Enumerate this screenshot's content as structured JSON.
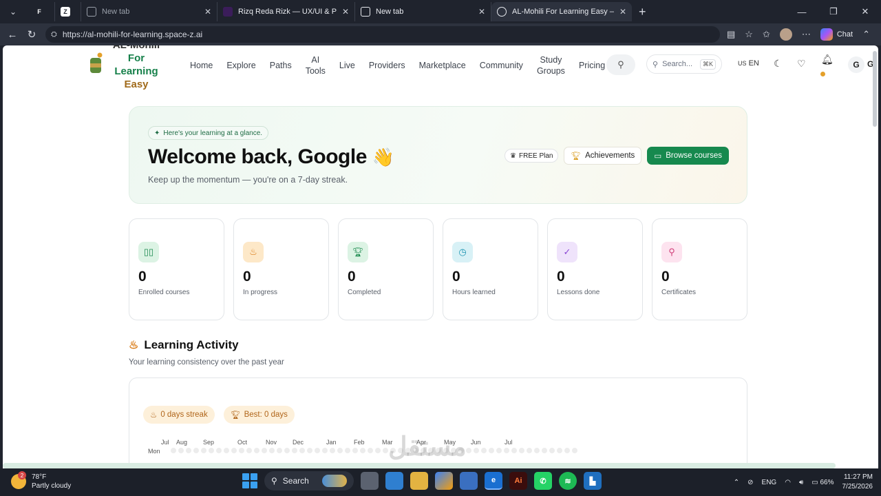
{
  "browser": {
    "tabs": [
      {
        "label": "",
        "favicon": "F",
        "color": "#ffffff"
      },
      {
        "label": "",
        "favicon": "Z",
        "color": "#ffffff"
      },
      {
        "label": "New tab",
        "favicon": "",
        "color": "#9aa0aa"
      },
      {
        "label": "Rizq Reda Rizk — UX/UI & Produc",
        "favicon": "",
        "color": "#e9ebf0"
      },
      {
        "label": "New tab",
        "favicon": "",
        "color": "#e9ebf0"
      },
      {
        "label": "AL-Mohili For Learning Easy — Ent",
        "favicon": "",
        "color": "#e9ebf0"
      }
    ],
    "url": "https://al-mohili-for-learning.space-z.ai",
    "chat_label": "Chat"
  },
  "header": {
    "logo_top": "AL-Mohili",
    "logo_for": "For",
    "logo_learning": "Learning",
    "logo_easy": "Easy",
    "nav": {
      "home": "Home",
      "explore": "Explore",
      "paths": "Paths",
      "ai_tools_1": "AI",
      "ai_tools_2": "Tools",
      "live": "Live",
      "providers": "Providers",
      "marketplace": "Marketplace",
      "community": "Community",
      "study_groups_1": "Study",
      "study_groups_2": "Groups",
      "pricing": "Pricing"
    },
    "search_placeholder": "Search...",
    "search_kbd": "⌘K",
    "lang_flag": "US",
    "lang": "EN",
    "user_initial": "G"
  },
  "hero": {
    "pill": "Here's your learning at a glance.",
    "title": "Welcome back, Google",
    "subtitle": "Keep up the momentum — you're on a 7-day streak.",
    "plan": "FREE Plan",
    "achievements": "Achievements",
    "browse": "Browse courses"
  },
  "stats": [
    {
      "value": "0",
      "label": "Enrolled courses",
      "icon": "book-icon",
      "bg": "#dcf3e4",
      "fg": "#1c8a4f"
    },
    {
      "value": "0",
      "label": "In progress",
      "icon": "flame-icon",
      "bg": "#fde8c8",
      "fg": "#d97a15"
    },
    {
      "value": "0",
      "label": "Completed",
      "icon": "trophy-icon",
      "bg": "#dcf3e4",
      "fg": "#1c8a4f"
    },
    {
      "value": "0",
      "label": "Hours learned",
      "icon": "clock-icon",
      "bg": "#d8f1f6",
      "fg": "#1b93b0"
    },
    {
      "value": "0",
      "label": "Lessons done",
      "icon": "check-circle-icon",
      "bg": "#efe3fb",
      "fg": "#8a45d4"
    },
    {
      "value": "0",
      "label": "Certificates",
      "icon": "award-icon",
      "bg": "#fde3ef",
      "fg": "#d0407a"
    }
  ],
  "activity": {
    "title": "Learning Activity",
    "subtitle": "Your learning consistency over the past year",
    "streak": "0 days streak",
    "best": "Best: 0 days",
    "months": [
      "Jul",
      "Aug",
      "Sep",
      "Oct",
      "Nov",
      "Dec",
      "Jan",
      "Feb",
      "Mar",
      "Apr",
      "May",
      "Jun",
      "Jul"
    ],
    "row_label": "Mon"
  },
  "watermark": "مستقل",
  "taskbar": {
    "temp": "78°F",
    "weather": "Partly cloudy",
    "weather_badge": "2",
    "search": "Search",
    "lang": "ENG",
    "battery": "66%",
    "time": "11:27 PM",
    "date": "7/25/2026"
  }
}
